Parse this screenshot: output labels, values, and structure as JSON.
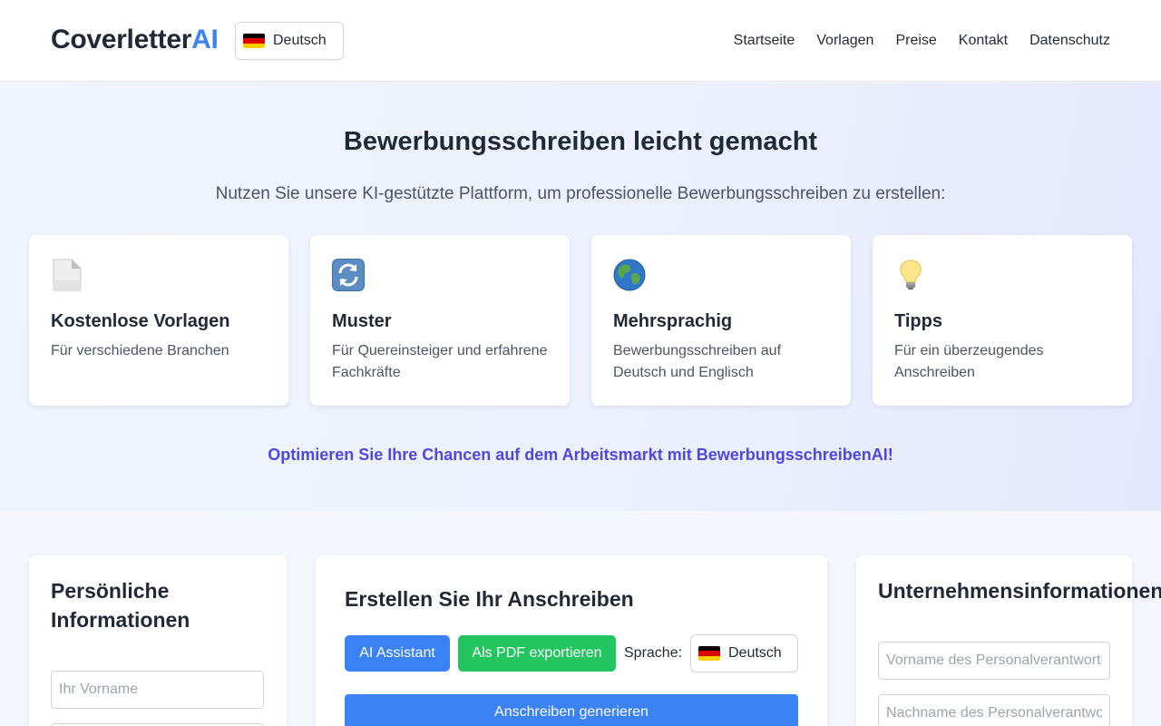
{
  "header": {
    "logo_main": "Coverletter",
    "logo_accent": "AI",
    "language": "Deutsch",
    "nav": [
      "Startseite",
      "Vorlagen",
      "Preise",
      "Kontakt",
      "Datenschutz"
    ]
  },
  "hero": {
    "title": "Bewerbungsschreiben leicht gemacht",
    "subtitle": "Nutzen Sie unsere KI-gestützte Plattform, um professionelle Bewerbungsschreiben zu erstellen:",
    "cards": [
      {
        "icon": "document-icon",
        "title": "Kostenlose Vorlagen",
        "text": "Für verschiedene Branchen"
      },
      {
        "icon": "refresh-icon",
        "title": "Muster",
        "text": "Für Quereinsteiger und erfahrene Fachkräfte"
      },
      {
        "icon": "globe-icon",
        "title": "Mehrsprachig",
        "text": "Bewerbungsschreiben auf Deutsch und Englisch"
      },
      {
        "icon": "lightbulb-icon",
        "title": "Tipps",
        "text": "Für ein überzeugendes Anschreiben"
      }
    ],
    "cta": "Optimieren Sie Ihre Chancen auf dem Arbeitsmarkt mit BewerbungsschreibenAI!"
  },
  "personal": {
    "title": "Persönliche Informationen",
    "firstname_placeholder": "Ihr Vorname"
  },
  "editor": {
    "title": "Erstellen Sie Ihr Anschreiben",
    "ai_button": "AI Assistant",
    "pdf_button": "Als PDF exportieren",
    "language_label": "Sprache:",
    "language": "Deutsch",
    "generate_button": "Anschreiben generieren"
  },
  "company": {
    "title": "Unternehmensinformationen",
    "hr_firstname_placeholder": "Vorname des Personalverantwortlichen",
    "hr_lastname_placeholder": "Nachname des Personalverantwortlichen"
  },
  "colors": {
    "accent": "#3b82f6",
    "success": "#22c55e",
    "cta": "#4f46e5"
  }
}
